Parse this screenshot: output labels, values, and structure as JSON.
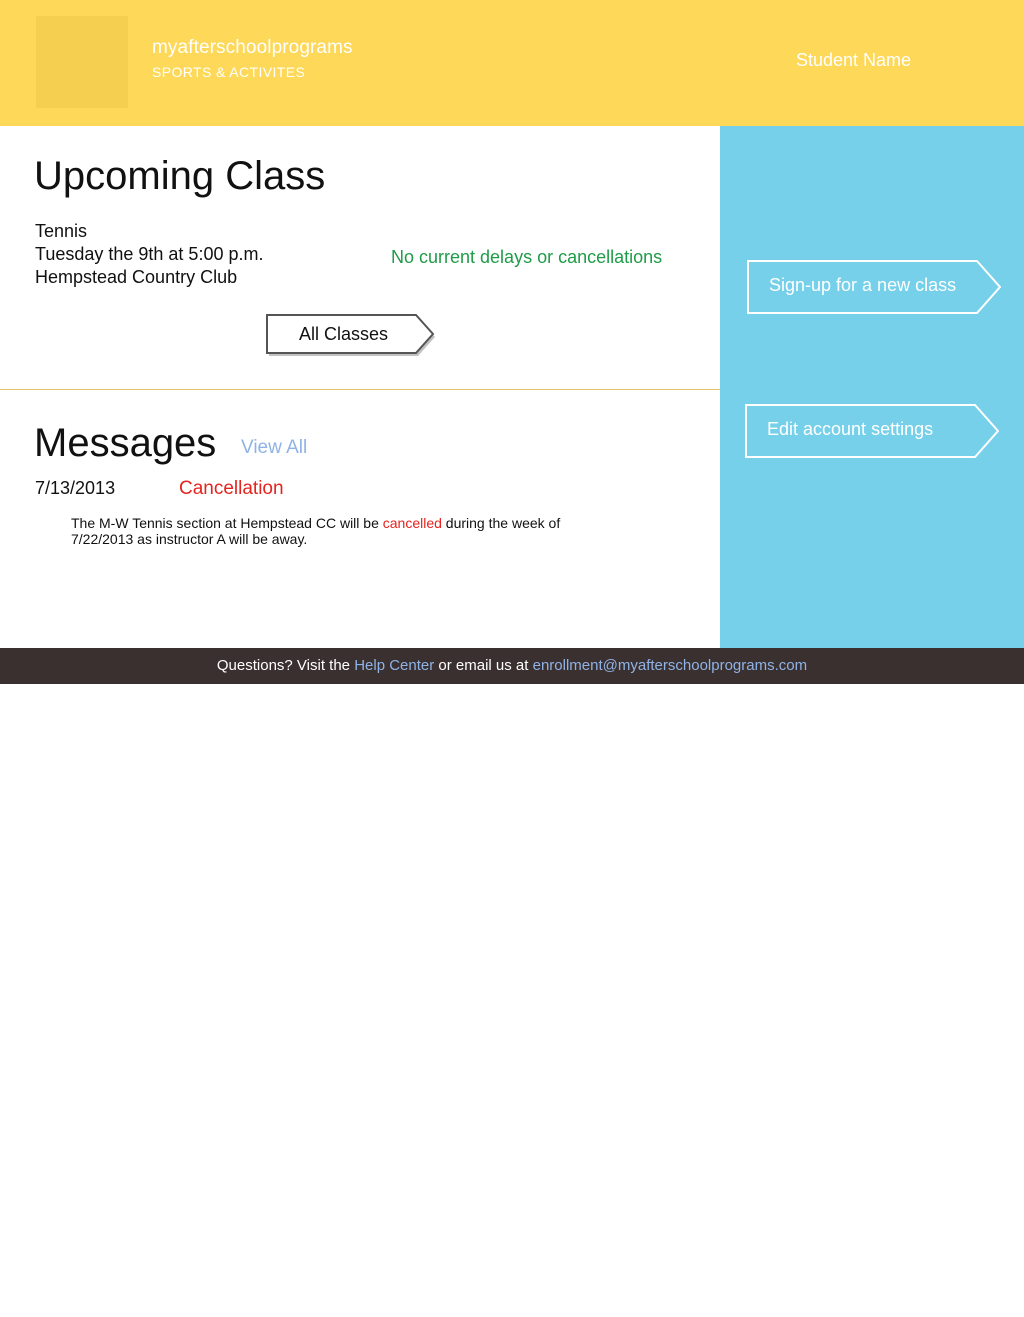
{
  "header": {
    "brand_name": "myafterschoolprograms",
    "brand_tagline": "SPORTS & ACTIVITES",
    "student_name": "Student Name"
  },
  "upcoming": {
    "title": "Upcoming Class",
    "class_name": "Tennis",
    "class_time": "Tuesday the 9th at 5:00 p.m.",
    "class_location": "Hempstead Country Club",
    "status": "No current delays or cancellations",
    "all_classes_label": "All Classes"
  },
  "messages": {
    "title": "Messages",
    "view_all_label": "View All",
    "items": [
      {
        "date": "7/13/2013",
        "type": "Cancellation",
        "body_before": "The M-W Tennis section at Hempstead CC will be ",
        "body_highlight": "cancelled",
        "body_after": " during the week of 7/22/2013 as instructor A will be away."
      }
    ]
  },
  "sidebar": {
    "signup_label": "Sign-up for a new class",
    "settings_label": "Edit account settings"
  },
  "footer": {
    "prefix": "Questions? Visit the ",
    "help_link": "Help Center",
    "middle": " or email us at ",
    "email_link": "enrollment@myafterschoolprograms.com"
  },
  "colors": {
    "header_bg": "#fed858",
    "sidebar_bg": "#76d0ea",
    "footer_bg": "#3a302f",
    "status_ok": "#1e9c47",
    "alert_red": "#e5231f",
    "link_blue": "#8fb3e6"
  }
}
